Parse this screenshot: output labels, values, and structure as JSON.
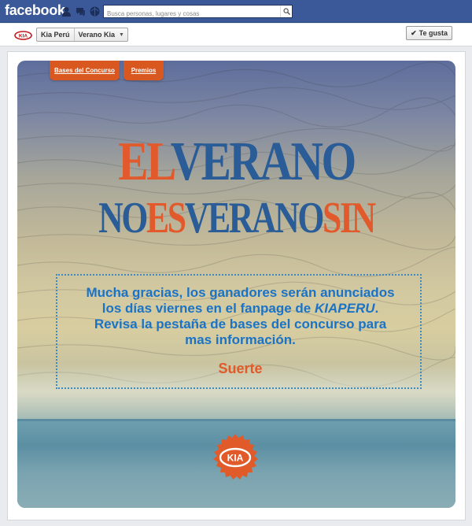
{
  "topbar": {
    "logo": "facebook",
    "search_placeholder": "Busca personas, lugares y cosas",
    "icons": [
      "friend-requests-icon",
      "messages-icon",
      "notifications-icon",
      "search-icon"
    ]
  },
  "pagebar": {
    "breadcrumb": [
      "Kia Perú",
      "Verano Kia"
    ],
    "like_label": "Te gusta"
  },
  "app": {
    "tabs": [
      "Bases del Concurso",
      "Premios"
    ],
    "headline": {
      "line1": [
        {
          "text": "EL",
          "color": "orange"
        },
        {
          "text": "VERANO",
          "color": "blue"
        }
      ],
      "line2": [
        {
          "text": "NO",
          "color": "blue"
        },
        {
          "text": "ES",
          "color": "orange"
        },
        {
          "text": "VERANO",
          "color": "blue"
        },
        {
          "text": "SIN",
          "color": "orange"
        }
      ]
    },
    "message": {
      "line1": "Mucha gracias, los ganadores serán  anunciados",
      "line2_pre": "los días viernes en el fanpage de ",
      "line2_em": "KIAPERU",
      "line2_post": ".",
      "line3": "Revisa la pestaña de bases del concurso para",
      "line4": "mas información."
    },
    "closing": "Suerte",
    "logo_text": "KIA"
  },
  "colors": {
    "fb_blue": "#3b5998",
    "orange": "#e25a2c",
    "blue": "#2a5c98",
    "message_blue": "#1a73c6"
  }
}
